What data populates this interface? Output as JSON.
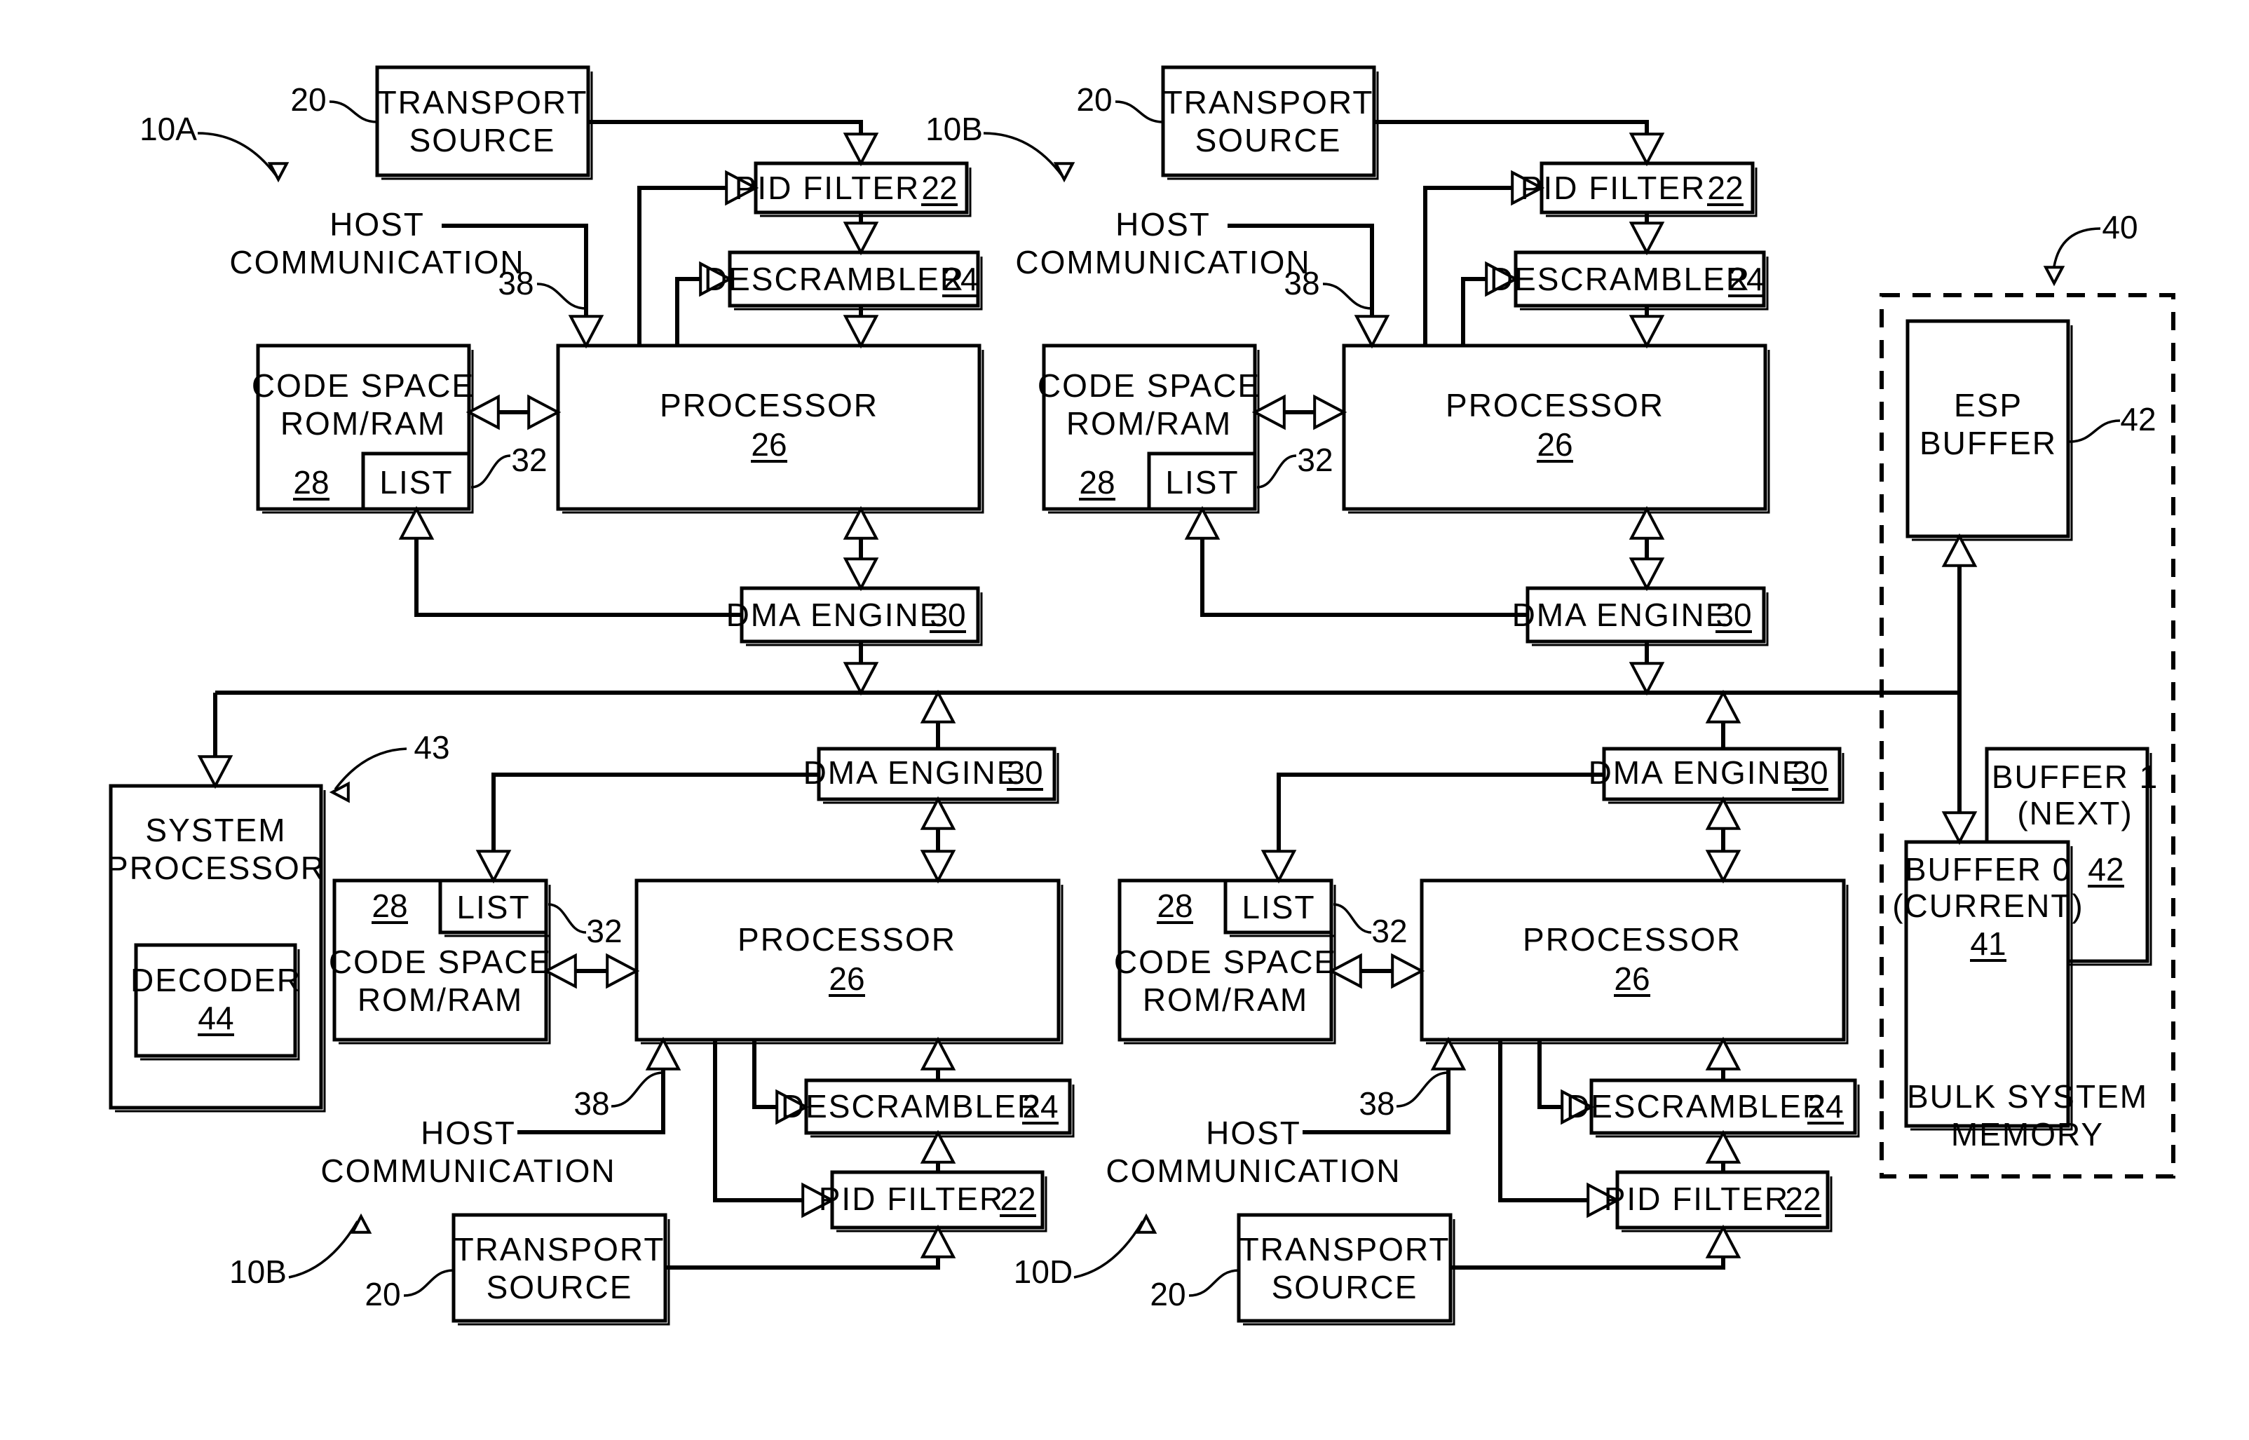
{
  "figure": {
    "type": "block-diagram",
    "modules": [
      {
        "id": "10A",
        "ref_label": "10A",
        "transport_source": {
          "label_line1": "TRANSPORT",
          "label_line2": "SOURCE",
          "ref": "20"
        },
        "pid_filter": {
          "label": "PID FILTER",
          "ref": "22"
        },
        "descrambler": {
          "label": "DESCRAMBLER",
          "ref": "24"
        },
        "processor": {
          "label": "PROCESSOR",
          "ref": "26"
        },
        "code_space": {
          "label_line1": "CODE SPACE",
          "label_line2": "ROM/RAM",
          "ref": "28"
        },
        "list": {
          "label": "LIST",
          "ref": "32"
        },
        "dma_engine": {
          "label": "DMA ENGINE",
          "ref": "30"
        },
        "host_comm": {
          "label_line1": "HOST",
          "label_line2": "COMMUNICATION",
          "ref": "38"
        }
      },
      {
        "id": "10B-top",
        "ref_label": "10B",
        "transport_source": {
          "label_line1": "TRANSPORT",
          "label_line2": "SOURCE",
          "ref": "20"
        },
        "pid_filter": {
          "label": "PID FILTER",
          "ref": "22"
        },
        "descrambler": {
          "label": "DESCRAMBLER",
          "ref": "24"
        },
        "processor": {
          "label": "PROCESSOR",
          "ref": "26"
        },
        "code_space": {
          "label_line1": "CODE SPACE",
          "label_line2": "ROM/RAM",
          "ref": "28"
        },
        "list": {
          "label": "LIST",
          "ref": "32"
        },
        "dma_engine": {
          "label": "DMA ENGINE",
          "ref": "30"
        },
        "host_comm": {
          "label_line1": "HOST",
          "label_line2": "COMMUNICATION",
          "ref": "38"
        }
      },
      {
        "id": "10B-bottom",
        "ref_label": "10B",
        "transport_source": {
          "label_line1": "TRANSPORT",
          "label_line2": "SOURCE",
          "ref": "20"
        },
        "pid_filter": {
          "label": "PID FILTER",
          "ref": "22"
        },
        "descrambler": {
          "label": "DESCRAMBLER",
          "ref": "24"
        },
        "processor": {
          "label": "PROCESSOR",
          "ref": "26"
        },
        "code_space": {
          "label_line1": "CODE SPACE",
          "label_line2": "ROM/RAM",
          "ref": "28"
        },
        "list": {
          "label": "LIST",
          "ref": "32"
        },
        "dma_engine": {
          "label": "DMA ENGINE",
          "ref": "30"
        },
        "host_comm": {
          "label_line1": "HOST",
          "label_line2": "COMMUNICATION",
          "ref": "38"
        }
      },
      {
        "id": "10D",
        "ref_label": "10D",
        "transport_source": {
          "label_line1": "TRANSPORT",
          "label_line2": "SOURCE",
          "ref": "20"
        },
        "pid_filter": {
          "label": "PID FILTER",
          "ref": "22"
        },
        "descrambler": {
          "label": "DESCRAMBLER",
          "ref": "24"
        },
        "processor": {
          "label": "PROCESSOR",
          "ref": "26"
        },
        "code_space": {
          "label_line1": "CODE SPACE",
          "label_line2": "ROM/RAM",
          "ref": "28"
        },
        "list": {
          "label": "LIST",
          "ref": "32"
        },
        "dma_engine": {
          "label": "DMA ENGINE",
          "ref": "30"
        },
        "host_comm": {
          "label_line1": "HOST",
          "label_line2": "COMMUNICATION",
          "ref": "38"
        }
      }
    ],
    "system_processor": {
      "label_line1": "SYSTEM",
      "label_line2": "PROCESSOR",
      "ref": "43",
      "decoder": {
        "label": "DECODER",
        "ref": "44"
      }
    },
    "bulk_memory": {
      "ref": "40",
      "label_line1": "BULK SYSTEM",
      "label_line2": "MEMORY",
      "esp_buffer": {
        "label_line1": "ESP",
        "label_line2": "BUFFER",
        "ref": "42"
      },
      "buffer0": {
        "label_line1": "BUFFER 0",
        "label_line2": "(CURRENT)",
        "ref": "41"
      },
      "buffer1": {
        "label_line1": "BUFFER 1",
        "label_line2": "(NEXT)",
        "ref": "42"
      }
    }
  }
}
